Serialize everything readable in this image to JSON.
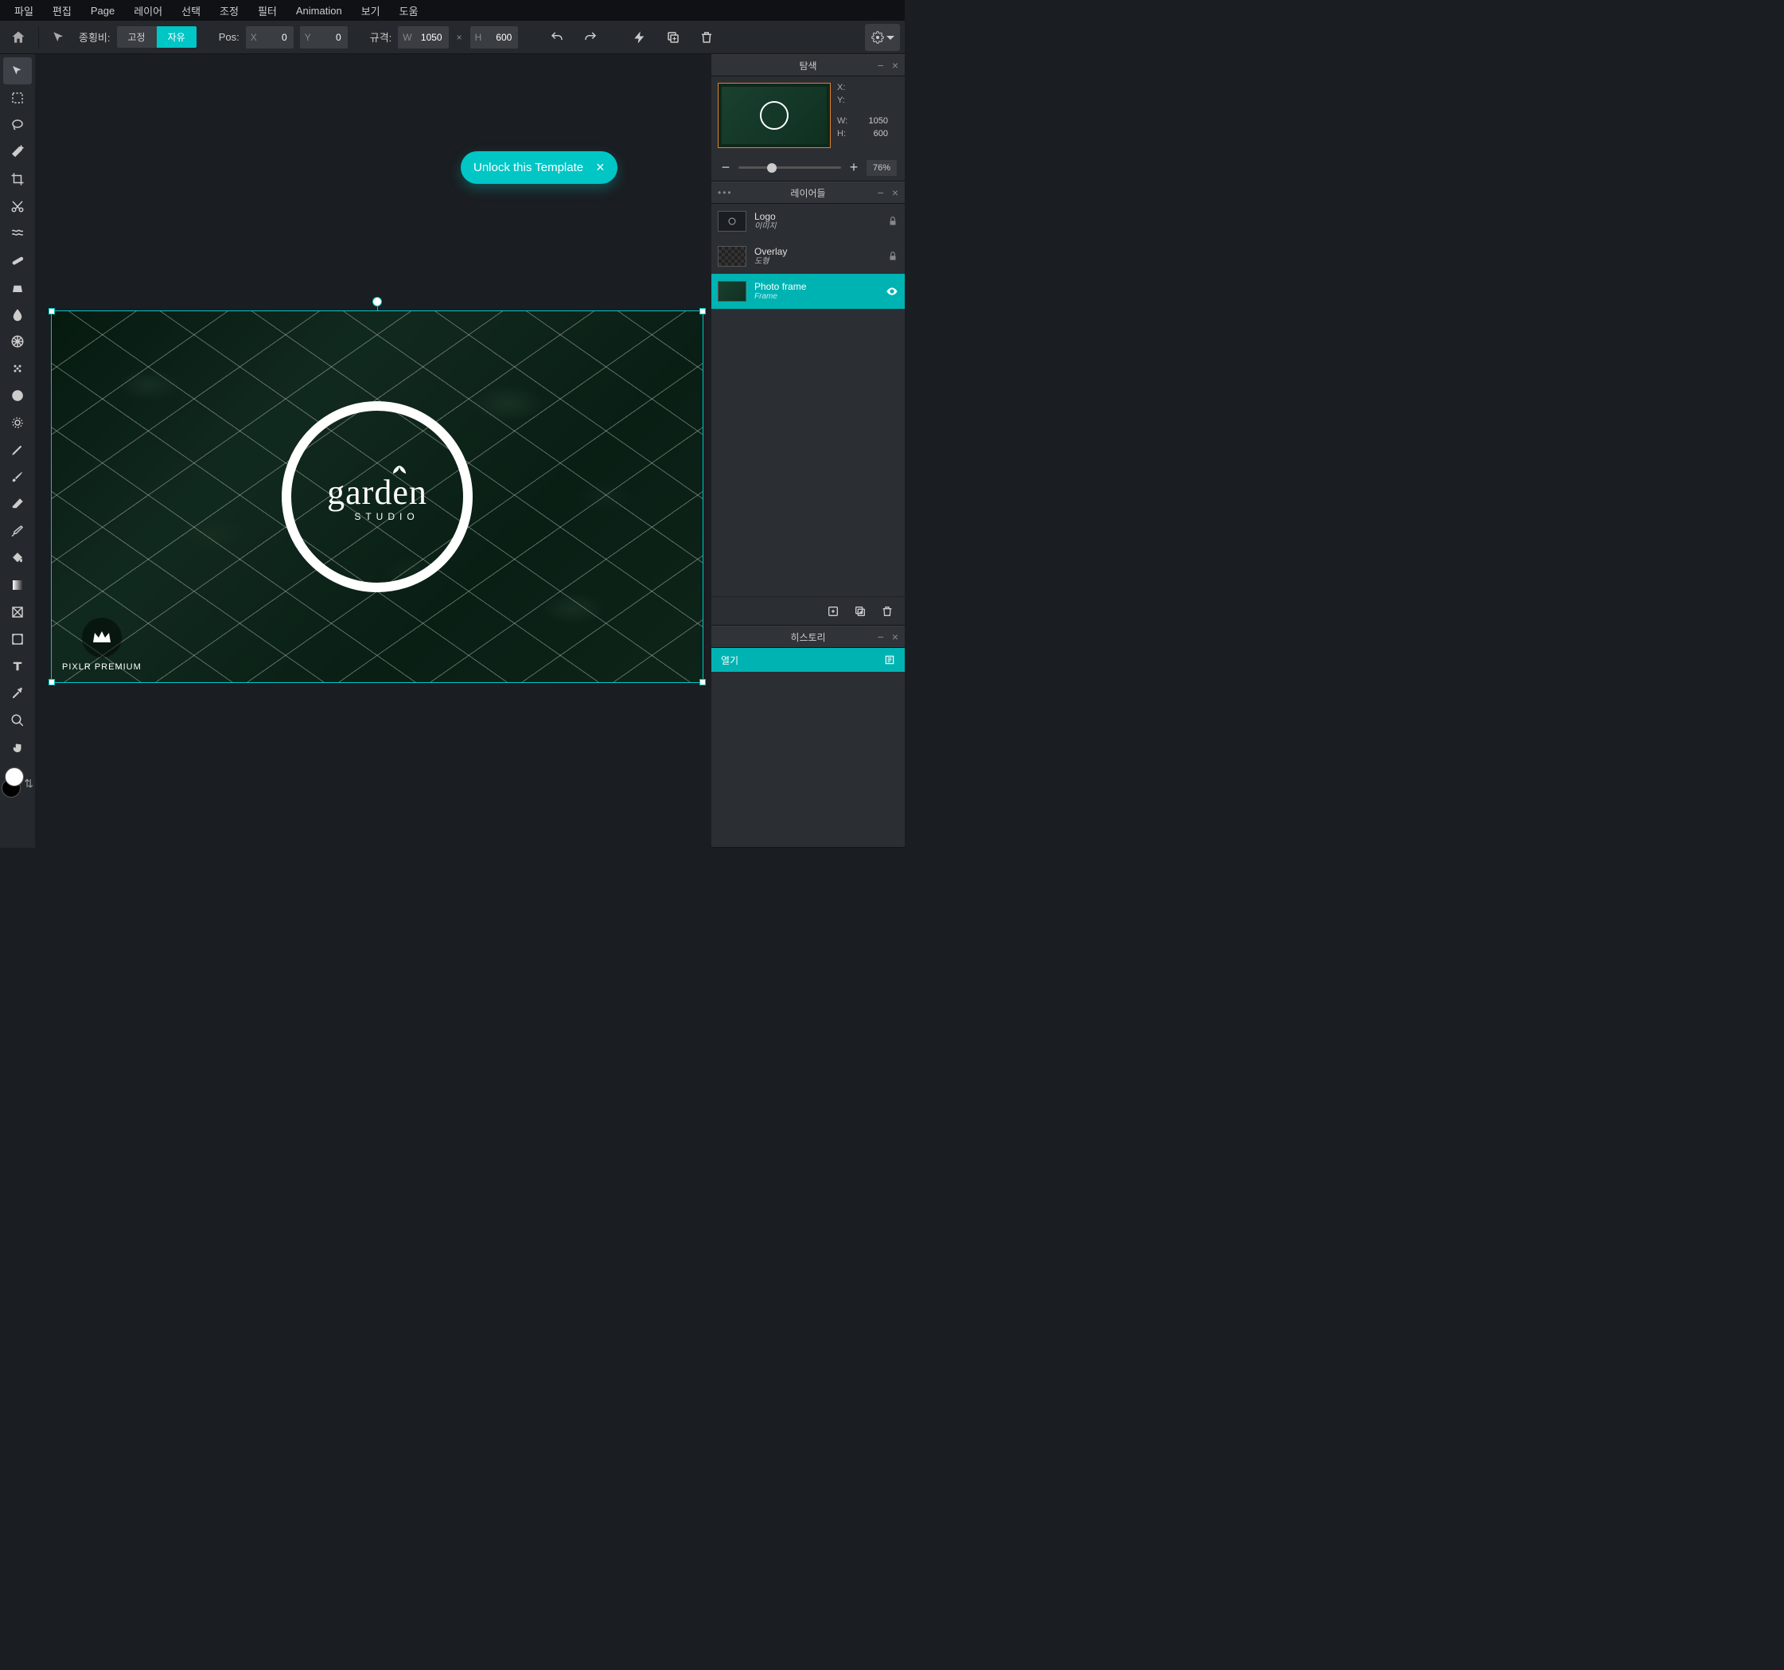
{
  "menu": [
    "파일",
    "편집",
    "Page",
    "레이어",
    "선택",
    "조정",
    "필터",
    "Animation",
    "보기",
    "도움"
  ],
  "optionsbar": {
    "aspect_label": "종횡비:",
    "aspect_fixed": "고정",
    "aspect_free": "자유",
    "pos_label": "Pos:",
    "pos_x_label": "X",
    "pos_x_value": "0",
    "pos_y_label": "Y",
    "pos_y_value": "0",
    "size_label": "규격:",
    "w_label": "W",
    "w_value": "1050",
    "h_label": "H",
    "h_value": "600"
  },
  "unlock": {
    "label": "Unlock this Template"
  },
  "canvas_logo": {
    "main": "garden",
    "sub": "STUDIO"
  },
  "premium_label": "PIXLR PREMIUM",
  "panel_titles": {
    "navigator": "탐색",
    "layers": "레이어들",
    "history": "히스토리"
  },
  "navigator": {
    "x_label": "X:",
    "y_label": "Y:",
    "w_label": "W:",
    "h_label": "H:",
    "w_value": "1050",
    "h_value": "600",
    "zoom": "76%"
  },
  "layers": [
    {
      "name": "Logo",
      "type": "이미지",
      "locked": true,
      "selected": false,
      "thumb": "logo"
    },
    {
      "name": "Overlay",
      "type": "도형",
      "locked": true,
      "selected": false,
      "thumb": "overlay"
    },
    {
      "name": "Photo frame",
      "type": "Frame",
      "locked": false,
      "selected": true,
      "thumb": "photo"
    }
  ],
  "history": [
    {
      "label": "열기",
      "current": true
    }
  ]
}
